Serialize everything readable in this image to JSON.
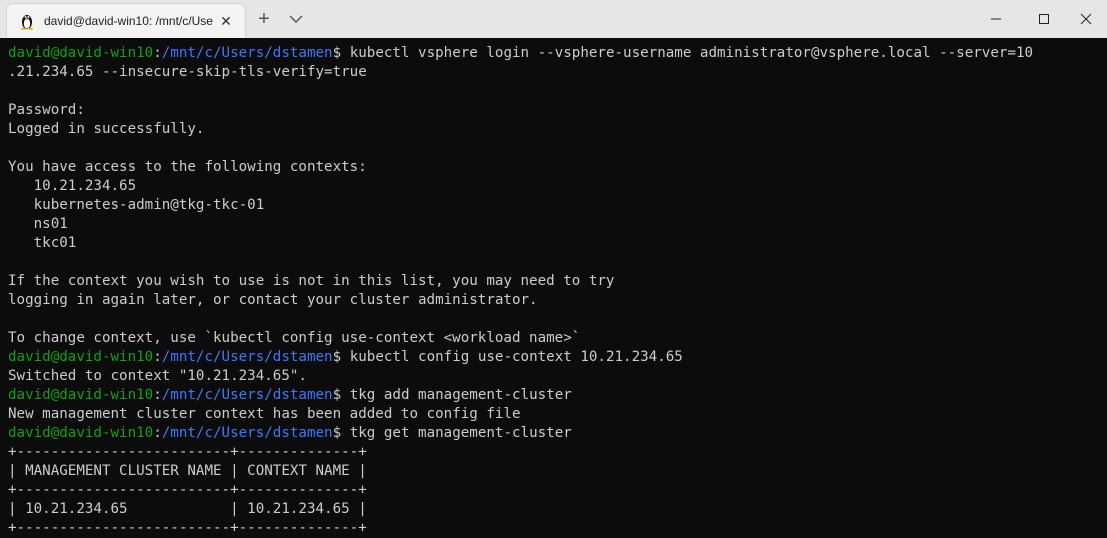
{
  "window": {
    "tab_title": "david@david-win10: /mnt/c/Use",
    "tab_icon": "linux-tux-icon",
    "close_tab_glyph": "✕",
    "new_tab_glyph": "+",
    "colors": {
      "titlebar": "#e6e6e6",
      "tab": "#f3f3f3",
      "terminal_bg": "#0c0c0c"
    }
  },
  "terminal": {
    "colors": {
      "prompt_user": "#13a10e",
      "prompt_path": "#3b78ff",
      "text": "#cccccc"
    },
    "lines": [
      {
        "type": "prompt",
        "user": "david@david-win10",
        "sep": ":",
        "path": "/mnt/c/Users/dstamen",
        "dollar": "$ ",
        "cmd": "kubectl vsphere login --vsphere-username administrator@vsphere.local --server=10"
      },
      {
        "type": "text",
        "text": ".21.234.65 --insecure-skip-tls-verify=true"
      },
      {
        "type": "text",
        "text": ""
      },
      {
        "type": "text",
        "text": "Password:"
      },
      {
        "type": "text",
        "text": "Logged in successfully."
      },
      {
        "type": "text",
        "text": ""
      },
      {
        "type": "text",
        "text": "You have access to the following contexts:"
      },
      {
        "type": "text",
        "text": "   10.21.234.65"
      },
      {
        "type": "text",
        "text": "   kubernetes-admin@tkg-tkc-01"
      },
      {
        "type": "text",
        "text": "   ns01"
      },
      {
        "type": "text",
        "text": "   tkc01"
      },
      {
        "type": "text",
        "text": ""
      },
      {
        "type": "text",
        "text": "If the context you wish to use is not in this list, you may need to try"
      },
      {
        "type": "text",
        "text": "logging in again later, or contact your cluster administrator."
      },
      {
        "type": "text",
        "text": ""
      },
      {
        "type": "text",
        "text": "To change context, use `kubectl config use-context <workload name>`"
      },
      {
        "type": "prompt",
        "user": "david@david-win10",
        "sep": ":",
        "path": "/mnt/c/Users/dstamen",
        "dollar": "$ ",
        "cmd": "kubectl config use-context 10.21.234.65"
      },
      {
        "type": "text",
        "text": "Switched to context \"10.21.234.65\"."
      },
      {
        "type": "prompt",
        "user": "david@david-win10",
        "sep": ":",
        "path": "/mnt/c/Users/dstamen",
        "dollar": "$ ",
        "cmd": "tkg add management-cluster"
      },
      {
        "type": "text",
        "text": "New management cluster context has been added to config file"
      },
      {
        "type": "prompt",
        "user": "david@david-win10",
        "sep": ":",
        "path": "/mnt/c/Users/dstamen",
        "dollar": "$ ",
        "cmd": "tkg get management-cluster"
      },
      {
        "type": "text",
        "text": "+-------------------------+--------------+"
      },
      {
        "type": "text",
        "text": "| MANAGEMENT CLUSTER NAME | CONTEXT NAME |"
      },
      {
        "type": "text",
        "text": "+-------------------------+--------------+"
      },
      {
        "type": "text",
        "text": "| 10.21.234.65            | 10.21.234.65 |"
      },
      {
        "type": "text",
        "text": "+-------------------------+--------------+"
      }
    ]
  }
}
